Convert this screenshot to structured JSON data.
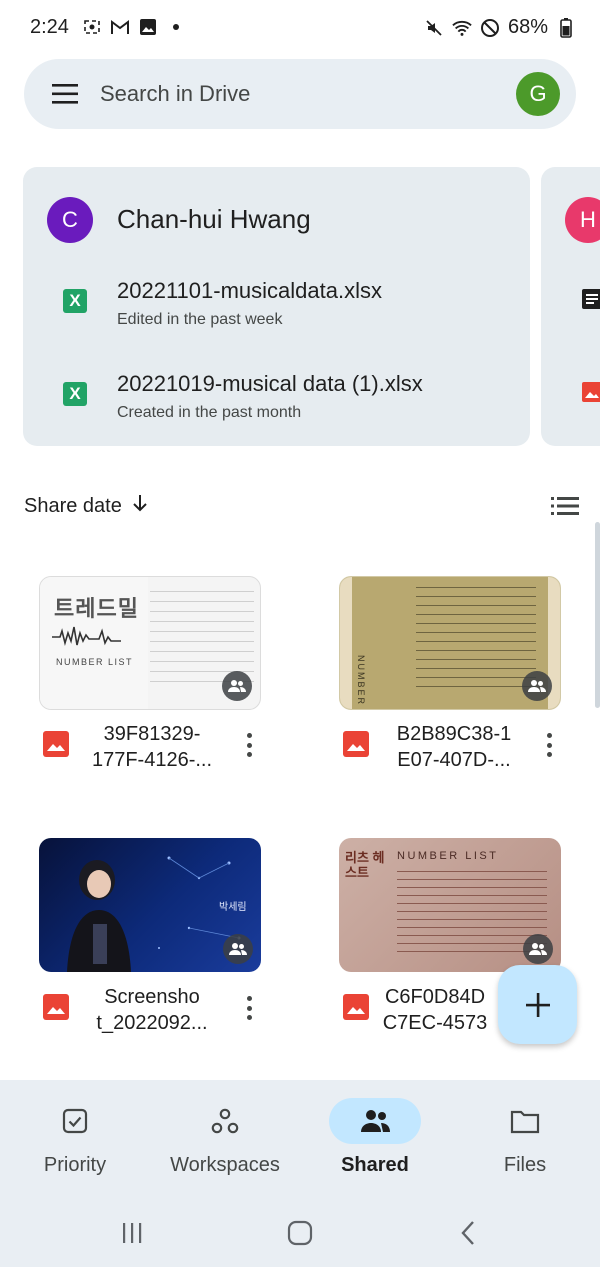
{
  "status_bar": {
    "time": "2:24",
    "battery": "68%"
  },
  "search": {
    "placeholder": "Search in Drive",
    "avatar_letter": "G",
    "avatar_color": "#4c9a2a"
  },
  "shared_cards": [
    {
      "avatar_letter": "C",
      "avatar_color": "#6a1bbd",
      "name": "Chan-hui Hwang",
      "files": [
        {
          "name": "20221101-musicaldata.xlsx",
          "meta": "Edited in the past week",
          "type": "X"
        },
        {
          "name": "20221019-musical data (1).xlsx",
          "meta": "Created in the past month",
          "type": "X"
        }
      ]
    },
    {
      "avatar_letter": "H",
      "avatar_color": "#e8396b"
    }
  ],
  "sort": {
    "label": "Share date"
  },
  "files": [
    {
      "name_line1": "39F81329-",
      "name_line2": "177F-4126-..."
    },
    {
      "name_line1": "B2B89C38-1",
      "name_line2": "E07-407D-..."
    },
    {
      "name_line1": "Screensho",
      "name_line2": "t_2022092..."
    },
    {
      "name_line1": "C6F0D84D",
      "name_line2": "C7EC-4573"
    }
  ],
  "thumb_text": {
    "t1_title": "트레드밀",
    "t1_sub": "NUMBER LIST",
    "t2_title": "NUMBER LIST",
    "t3_caption": "박세림",
    "t4_logo": "리츠 헤스트",
    "t4_title": "NUMBER LIST"
  },
  "nav": {
    "items": [
      {
        "label": "Priority",
        "icon": "priority-check-icon"
      },
      {
        "label": "Workspaces",
        "icon": "workspaces-icon"
      },
      {
        "label": "Shared",
        "icon": "shared-people-icon",
        "active": true
      },
      {
        "label": "Files",
        "icon": "folder-icon"
      }
    ]
  },
  "colors": {
    "accent": "#c2e7ff",
    "card_bg": "#e6ecf0",
    "nav_bg": "#e9eef3",
    "image_icon": "#ea4335",
    "xlsx_icon": "#21a366"
  }
}
